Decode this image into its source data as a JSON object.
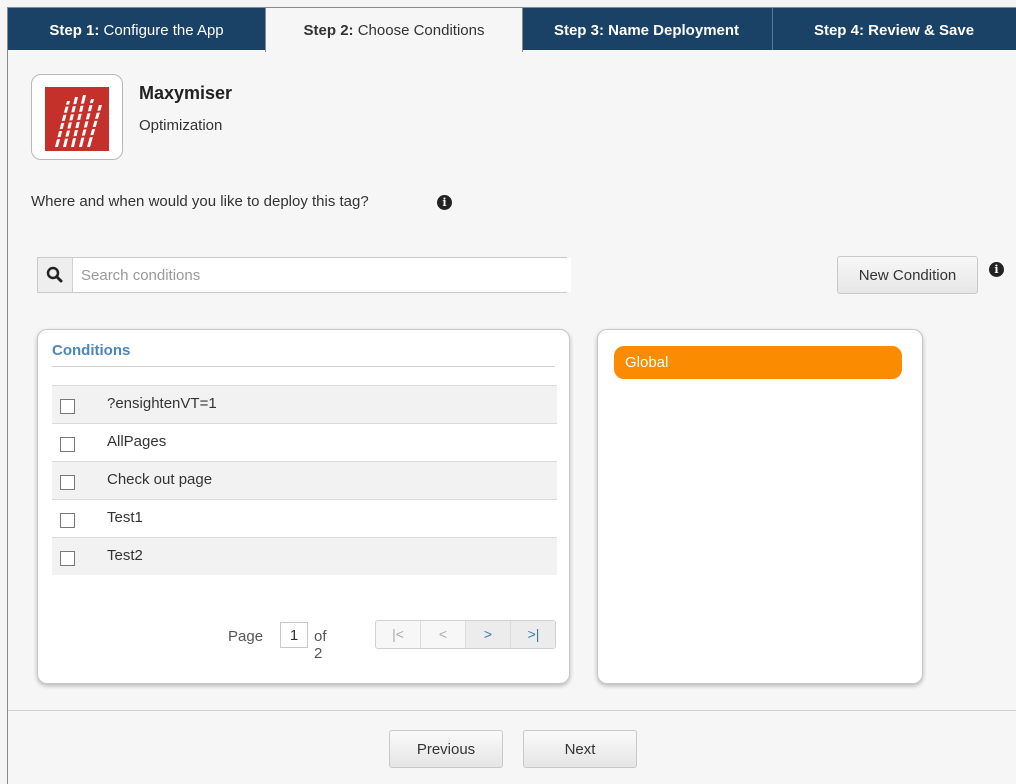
{
  "tabs": [
    {
      "step": "Step 1:",
      "label": "Configure the App"
    },
    {
      "step": "Step 2:",
      "label": "Choose Conditions"
    },
    {
      "step": "Step 3:",
      "label": "Name Deployment"
    },
    {
      "step": "Step 4:",
      "label": "Review & Save"
    }
  ],
  "app": {
    "name": "Maxymiser",
    "category": "Optimization"
  },
  "question": "Where and when would you like to deploy this tag?",
  "info_glyph": "i",
  "search": {
    "placeholder": "Search conditions",
    "value": ""
  },
  "new_condition_label": "New Condition",
  "conditions": {
    "title": "Conditions",
    "items": [
      {
        "label": "?ensightenVT=1",
        "checked": false
      },
      {
        "label": "AllPages",
        "checked": false
      },
      {
        "label": "Check out page",
        "checked": false
      },
      {
        "label": "Test1",
        "checked": false
      },
      {
        "label": "Test2",
        "checked": false
      }
    ],
    "pager": {
      "page_label": "Page",
      "page": "1",
      "of_label": "of 2",
      "first": "|<",
      "prev": "<",
      "next": ">",
      "last": ">|"
    }
  },
  "selected": {
    "items": [
      "Global"
    ]
  },
  "colors": {
    "tab_bar": "#1a4166",
    "selected_item": "#fb8b00",
    "link": "#4a86bd"
  },
  "footer": {
    "previous": "Previous",
    "next": "Next"
  }
}
